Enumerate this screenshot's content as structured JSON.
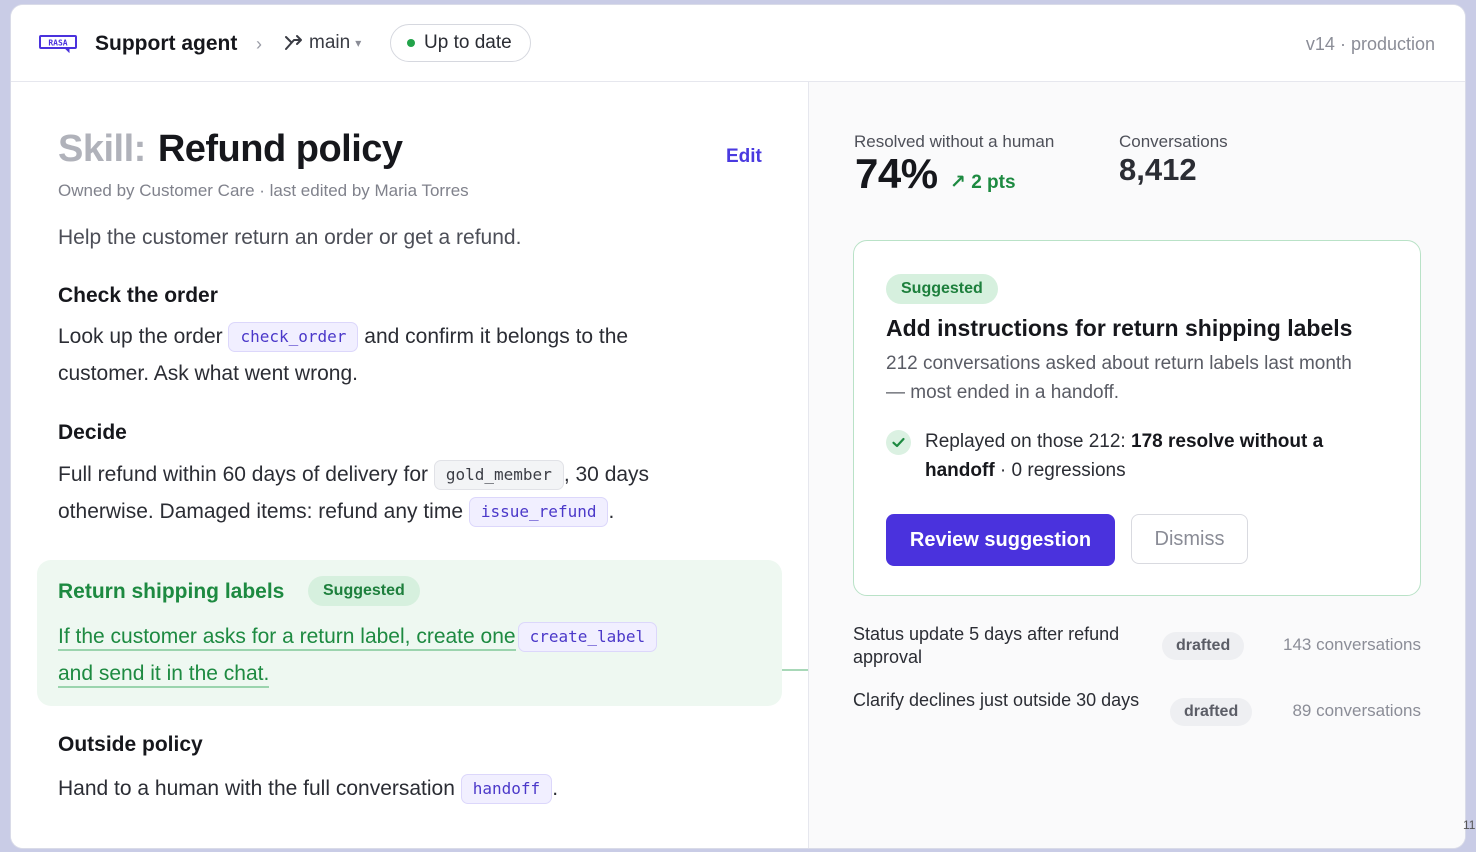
{
  "header": {
    "app_title": "Support agent",
    "separator": "›",
    "branch": "main",
    "branch_caret": "▾",
    "status": "Up to date",
    "version": "v14 · production",
    "logo_text": "RASA"
  },
  "skill": {
    "prefix": "Skill:",
    "title": "Refund policy",
    "edit_label": "Edit",
    "owner_line": "Owned by Customer Care · last edited by Maria Torres",
    "intro": "Help the customer return an order or get a refund."
  },
  "sections": {
    "check": {
      "heading": "Check the order",
      "text_before": "Look up the order",
      "tool": "check_order",
      "text_after": "and confirm it belongs to the",
      "line2": "customer. Ask what went wrong."
    },
    "decide": {
      "heading": "Decide",
      "text_before": "Full refund within 60 days of delivery for",
      "tool1": "gold_member",
      "text_mid": ", 30 days",
      "line2_before": "otherwise. Damaged items: refund any time",
      "tool2": "issue_refund",
      "line2_after": "."
    },
    "return_labels": {
      "heading": "Return shipping labels",
      "badge": "Suggested",
      "text_before": "If the customer asks for a return label, create one",
      "tool": "create_label",
      "line2": "and send it in the chat."
    },
    "outside": {
      "heading": "Outside policy",
      "text_before": "Hand to a human with the full conversation",
      "tool": "handoff",
      "text_after": "."
    }
  },
  "stats": {
    "resolved_label": "Resolved without a human",
    "resolved_value": "74%",
    "resolved_delta": "↗ 2 pts",
    "conversations_label": "Conversations",
    "conversations_value": "8,412"
  },
  "suggestion_card": {
    "badge": "Suggested",
    "title": "Add instructions for return shipping labels",
    "description": "212 conversations asked about return labels last month — most ended in a handoff.",
    "replay_before": "Replayed on those 212: ",
    "replay_bold": "178 resolve without a handoff",
    "replay_after": " · 0 regressions",
    "primary_button": "Review suggestion",
    "secondary_button": "Dismiss"
  },
  "pending": [
    {
      "title": "Status update 5 days after refund approval",
      "badge": "drafted",
      "count": "143 conversations"
    },
    {
      "title": "Clarify declines just outside 30 days",
      "badge": "drafted",
      "count": "89 conversations"
    }
  ],
  "colors": {
    "accent": "#4a32dd",
    "success": "#1d8a41",
    "suggest_bg": "#eef8f1"
  },
  "corner_glyph": "11"
}
